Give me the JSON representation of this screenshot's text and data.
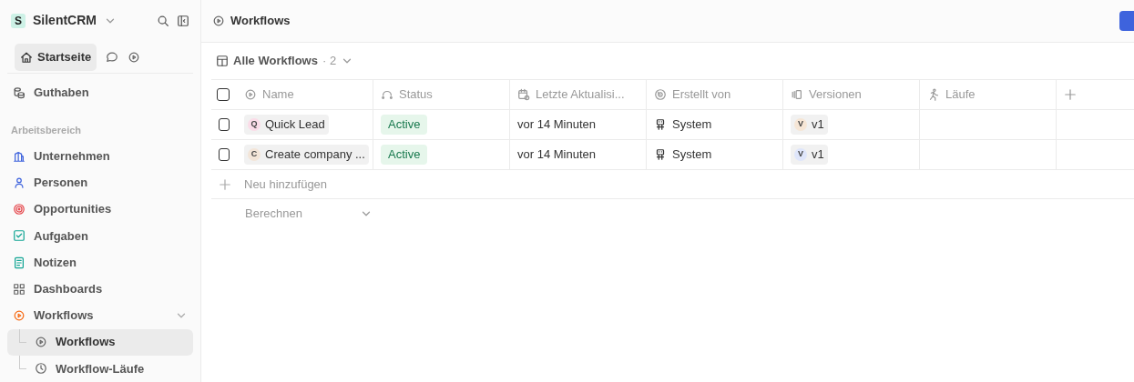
{
  "workspace": {
    "initial": "S",
    "name": "SilentCRM"
  },
  "sidebar": {
    "home": {
      "label": "Startseite",
      "selected": true
    },
    "credits": {
      "label": "Guthaben"
    },
    "section_title": "Arbeitsbereich",
    "items": [
      {
        "label": "Unternehmen",
        "selected": false
      },
      {
        "label": "Personen",
        "selected": false
      },
      {
        "label": "Opportunities",
        "selected": false
      },
      {
        "label": "Aufgaben",
        "selected": false
      },
      {
        "label": "Notizen",
        "selected": false
      },
      {
        "label": "Dashboards",
        "selected": false
      },
      {
        "label": "Workflows",
        "selected": false,
        "expanded": true,
        "children": [
          {
            "label": "Workflows",
            "selected": true
          },
          {
            "label": "Workflow-Läufe",
            "selected": false
          }
        ]
      }
    ]
  },
  "page": {
    "title": "Workflows"
  },
  "view": {
    "name": "Alle Workflows",
    "count": "· 2"
  },
  "table": {
    "select_all_checked": false,
    "columns": [
      "Name",
      "Status",
      "Letzte Aktualisi...",
      "Erstellt von",
      "Versionen",
      "Läufe"
    ],
    "rows": [
      {
        "checked": false,
        "name_initial": "Q",
        "name": "Quick Lead",
        "status": "Active",
        "updated": "vor 14 Minuten",
        "created_by": "System",
        "version_initial": "V",
        "version": "v1"
      },
      {
        "checked": false,
        "name_initial": "C",
        "name": "Create company ...",
        "status": "Active",
        "updated": "vor 14 Minuten",
        "created_by": "System",
        "version_initial": "V",
        "version": "v1"
      }
    ],
    "add_row": "Neu hinzufügen",
    "aggregate": "Berechnen"
  }
}
